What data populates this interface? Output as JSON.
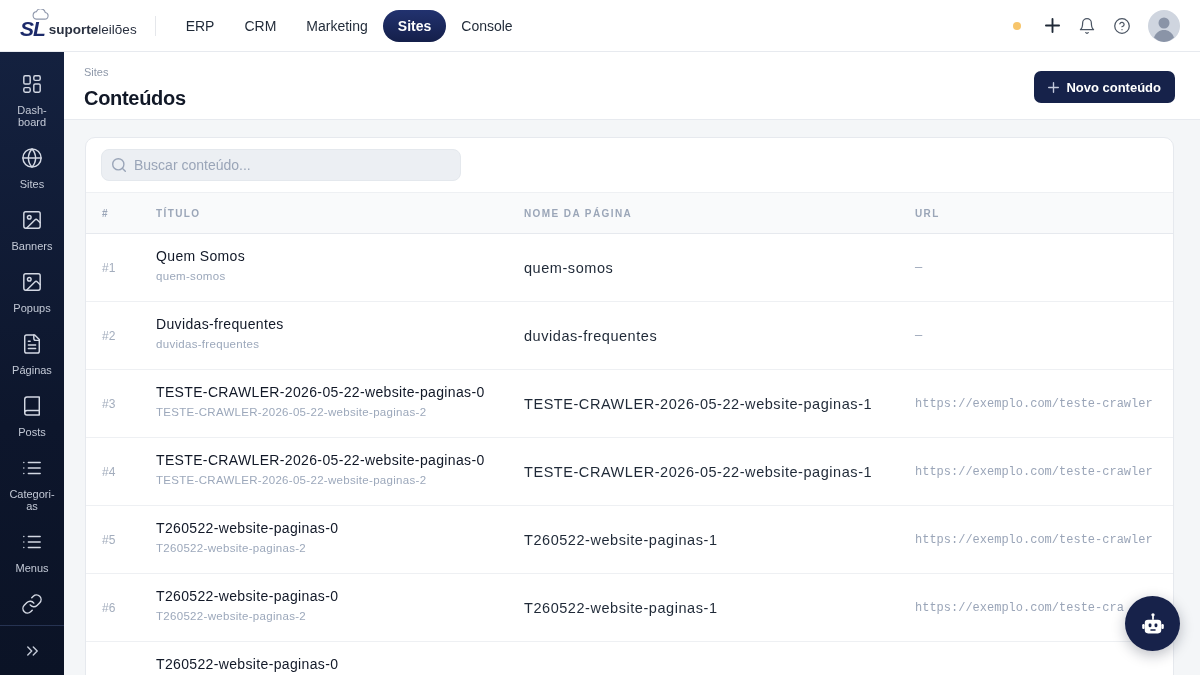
{
  "top_bar": {
    "logo": {
      "mark": "SL",
      "name": "**suporte**leilões"
    },
    "nav": [
      {
        "label": "ERP",
        "selected": false
      },
      {
        "label": "CRM",
        "selected": false
      },
      {
        "label": "Marketing",
        "selected": false
      },
      {
        "label": "Sites",
        "selected": true
      },
      {
        "label": "Console",
        "selected": false
      }
    ]
  },
  "sidebar": {
    "items": [
      {
        "label": "Dash-board"
      },
      {
        "label": "Sites"
      },
      {
        "label": "Banners"
      },
      {
        "label": "Popups"
      },
      {
        "label": "Páginas"
      },
      {
        "label": "Posts"
      },
      {
        "label": "Categori-as"
      },
      {
        "label": "Menus"
      }
    ]
  },
  "header": {
    "breadcrumb": "Sites",
    "title": "Conteúdos",
    "new_button": "Novo conteúdo"
  },
  "search": {
    "placeholder": "Buscar conteúdo..."
  },
  "table": {
    "columns": [
      "#",
      "TÍTULO",
      "NOME DA PÁGINA",
      "URL"
    ],
    "rows": [
      {
        "number": "#1",
        "title": "Quem Somos",
        "slug": "quem-somos",
        "page_name": "quem-somos",
        "url": "—"
      },
      {
        "number": "#2",
        "title": "Duvidas-frequentes",
        "slug": "duvidas-frequentes",
        "page_name": "duvidas-frequentes",
        "url": "—"
      },
      {
        "number": "#3",
        "title": "TESTE-CRAWLER-2026-05-22-website-paginas-0",
        "slug": "TESTE-CRAWLER-2026-05-22-website-paginas-2",
        "page_name": "TESTE-CRAWLER-2026-05-22-website-paginas-1",
        "url": "https://exemplo.com/teste-crawler"
      },
      {
        "number": "#4",
        "title": "TESTE-CRAWLER-2026-05-22-website-paginas-0",
        "slug": "TESTE-CRAWLER-2026-05-22-website-paginas-2",
        "page_name": "TESTE-CRAWLER-2026-05-22-website-paginas-1",
        "url": "https://exemplo.com/teste-crawler"
      },
      {
        "number": "#5",
        "title": "T260522-website-paginas-0",
        "slug": "T260522-website-paginas-2",
        "page_name": "T260522-website-paginas-1",
        "url": "https://exemplo.com/teste-crawler"
      },
      {
        "number": "#6",
        "title": "T260522-website-paginas-0",
        "slug": "T260522-website-paginas-2",
        "page_name": "T260522-website-paginas-1",
        "url": "https://exemplo.com/teste-cra"
      },
      {
        "title": "T260522-website-paginas-0"
      }
    ]
  }
}
